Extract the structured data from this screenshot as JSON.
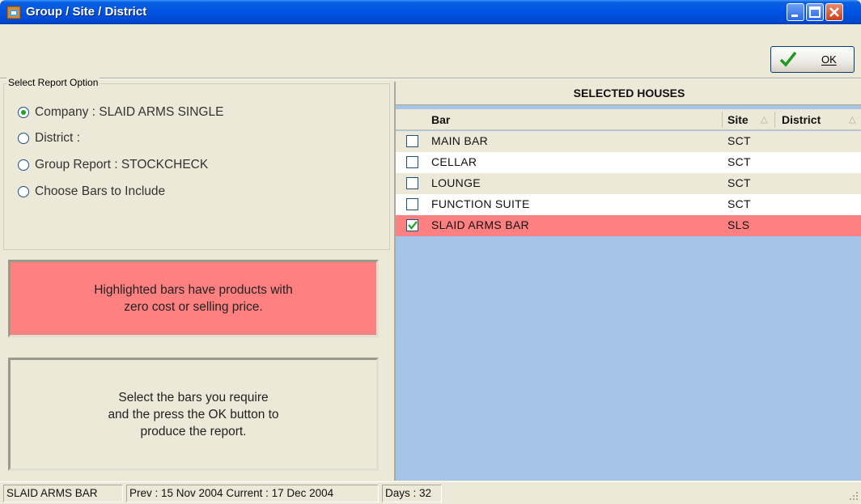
{
  "window": {
    "title": "Group / Site / District"
  },
  "toolbar": {
    "ok_label": "OK"
  },
  "report_options": {
    "legend": "Select Report Option",
    "options": [
      {
        "label": "Company : SLAID ARMS SINGLE",
        "checked": true
      },
      {
        "label": "District :",
        "checked": false
      },
      {
        "label": "Group Report : STOCKCHECK",
        "checked": false
      },
      {
        "label": "Choose Bars to Include",
        "checked": false
      }
    ]
  },
  "info": {
    "highlight_note": "Highlighted bars have products with\nzero cost or selling price.",
    "instructions": "Select the bars you require\nand the press the OK button to\nproduce the report."
  },
  "houses": {
    "title": "SELECTED HOUSES",
    "columns": {
      "bar": "Bar",
      "site": "Site",
      "district": "District"
    },
    "rows": [
      {
        "bar": "MAIN BAR",
        "site": "SCT",
        "checked": false,
        "highlighted": false
      },
      {
        "bar": "CELLAR",
        "site": "SCT",
        "checked": false,
        "highlighted": false
      },
      {
        "bar": "LOUNGE",
        "site": "SCT",
        "checked": false,
        "highlighted": false
      },
      {
        "bar": "FUNCTION SUITE",
        "site": "SCT",
        "checked": false,
        "highlighted": false
      },
      {
        "bar": "SLAID ARMS BAR",
        "site": "SLS",
        "checked": true,
        "highlighted": true
      }
    ]
  },
  "status": {
    "bar_name": "SLAID ARMS BAR",
    "dates": "Prev : 15 Nov 2004  Current : 17 Dec 2004",
    "days": "Days : 32"
  },
  "colors": {
    "highlight": "#FF8080",
    "grid_background": "#A6C4E8",
    "titlebar": "#0054E3"
  }
}
